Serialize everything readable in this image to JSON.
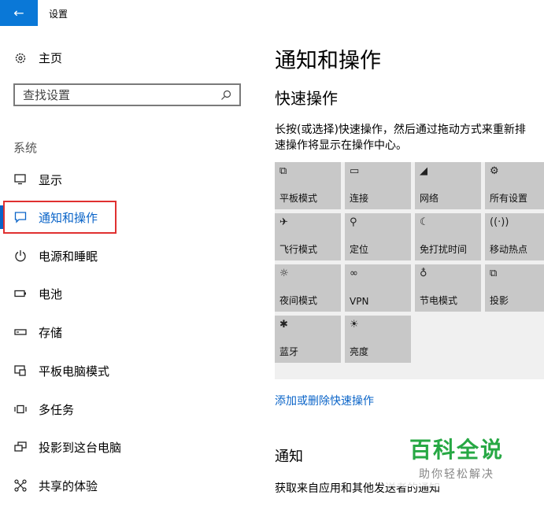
{
  "window": {
    "title": "设置",
    "back_icon": "←"
  },
  "sidebar": {
    "home_label": "主页",
    "search_placeholder": "查找设置",
    "section_label": "系统",
    "items": [
      {
        "label": "显示",
        "icon": "monitor-icon"
      },
      {
        "label": "通知和操作",
        "icon": "message-icon",
        "active": true
      },
      {
        "label": "电源和睡眠",
        "icon": "power-icon"
      },
      {
        "label": "电池",
        "icon": "battery-icon"
      },
      {
        "label": "存储",
        "icon": "storage-icon"
      },
      {
        "label": "平板电脑模式",
        "icon": "tablet-icon"
      },
      {
        "label": "多任务",
        "icon": "multitask-icon"
      },
      {
        "label": "投影到这台电脑",
        "icon": "project-icon"
      },
      {
        "label": "共享的体验",
        "icon": "share-icon"
      }
    ]
  },
  "main": {
    "title": "通知和操作",
    "quick_actions_heading": "快速操作",
    "description_line1": "长按(或选择)快速操作，然后通过拖动方式来重新排",
    "description_line2": "速操作将显示在操作中心。",
    "tiles": [
      {
        "label": "平板模式",
        "glyph": "⧉"
      },
      {
        "label": "连接",
        "glyph": "▭"
      },
      {
        "label": "网络",
        "glyph": "◢"
      },
      {
        "label": "所有设置",
        "glyph": "⚙"
      },
      {
        "label": "飞行模式",
        "glyph": "✈"
      },
      {
        "label": "定位",
        "glyph": "⚲"
      },
      {
        "label": "免打扰时间",
        "glyph": "☾"
      },
      {
        "label": "移动热点",
        "glyph": "((·))"
      },
      {
        "label": "夜间模式",
        "glyph": "☼"
      },
      {
        "label": "VPN",
        "glyph": "∞"
      },
      {
        "label": "节电模式",
        "glyph": "♁"
      },
      {
        "label": "投影",
        "glyph": "⧉"
      },
      {
        "label": "蓝牙",
        "glyph": "✱"
      },
      {
        "label": "亮度",
        "glyph": "☀"
      }
    ],
    "add_remove_link": "添加或删除快速操作",
    "notifications_heading": "通知",
    "notifications_desc": "获取来自应用和其他发送者的通知"
  },
  "watermark": {
    "main": "百科全说",
    "sub": "助你轻松解决"
  },
  "colors": {
    "accent": "#0a64c8",
    "titlebar_back": "#0a78d7",
    "highlight_frame": "#e03030",
    "tile_bg": "#c8c8c8"
  }
}
